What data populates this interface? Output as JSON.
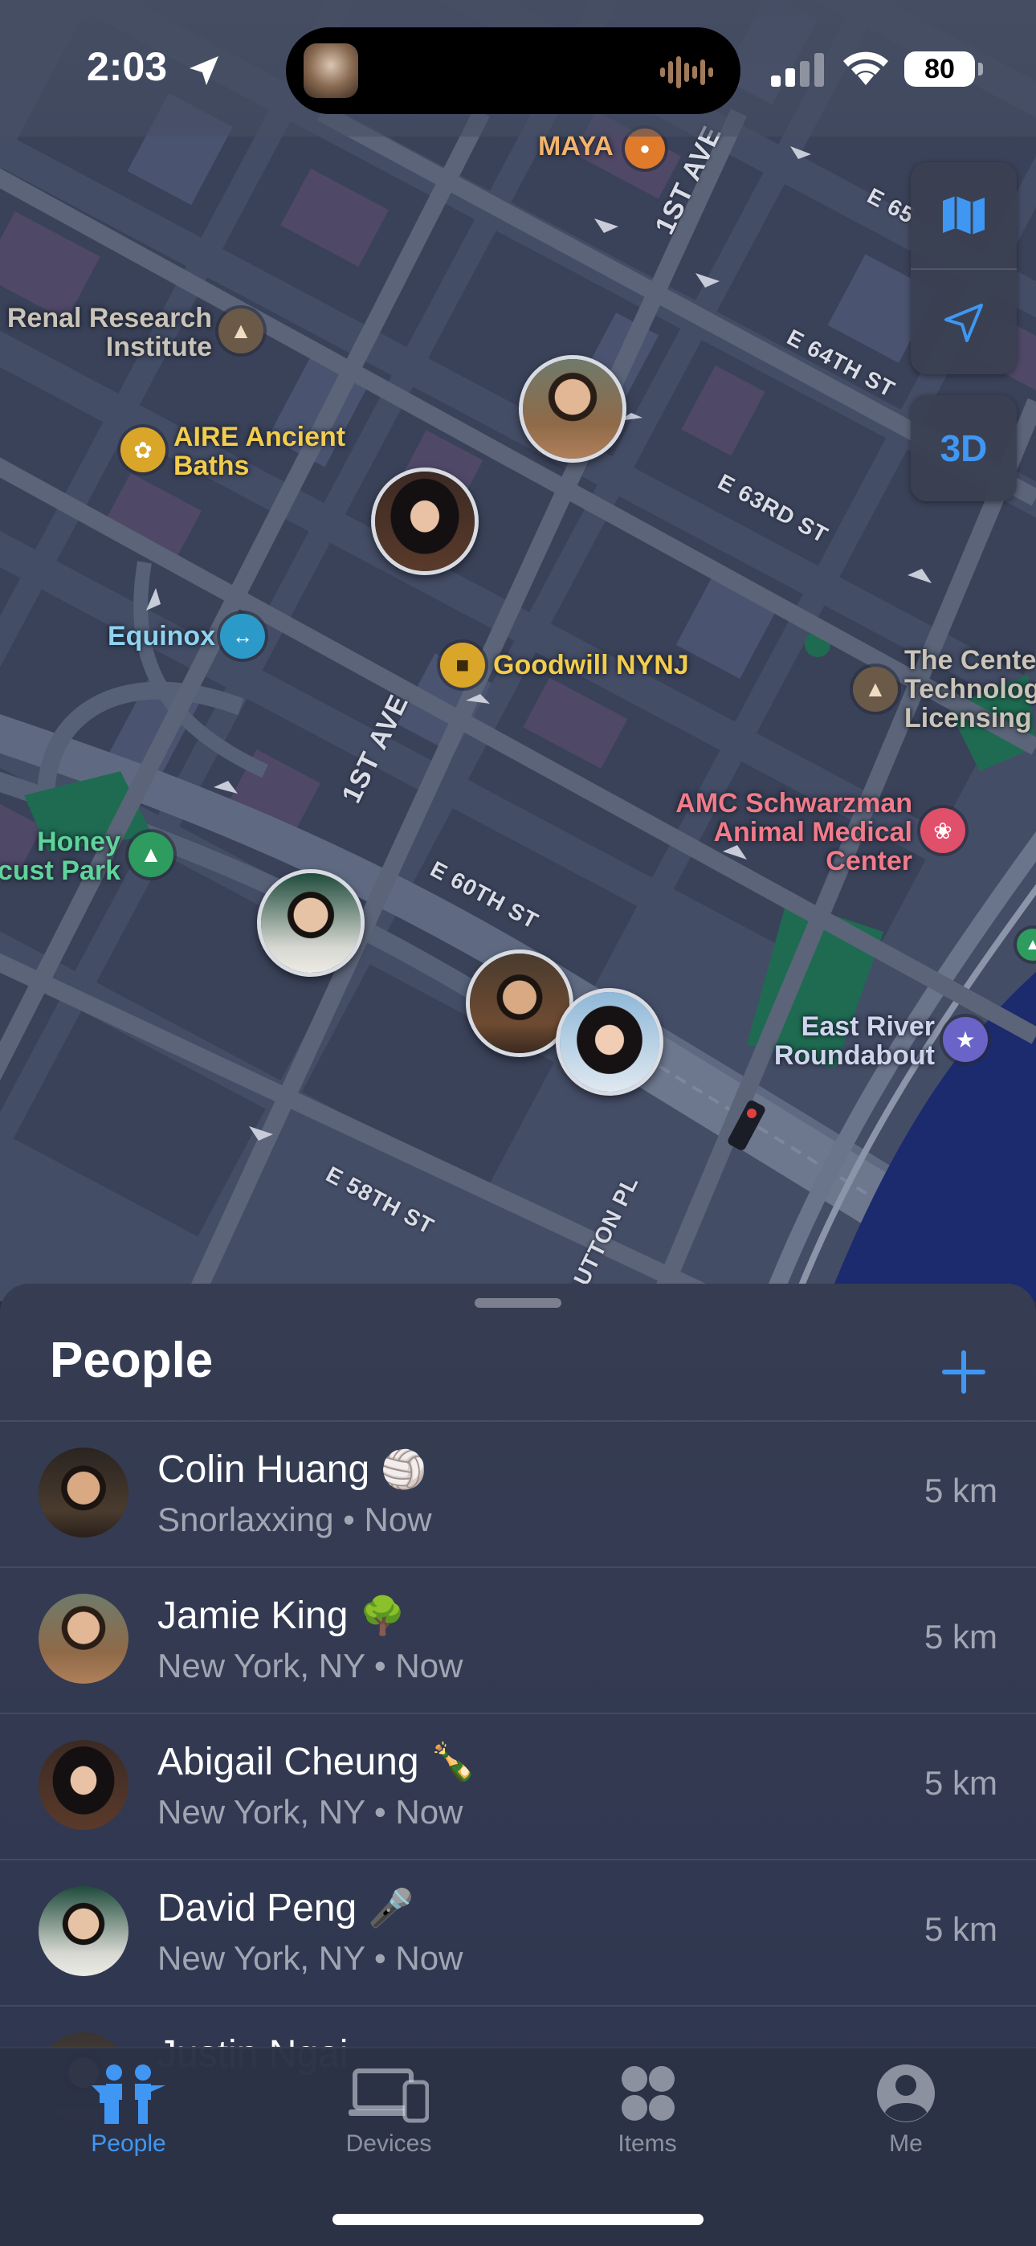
{
  "status_bar": {
    "time": "2:03",
    "battery": "80"
  },
  "map": {
    "places": {
      "maya": "MAYA",
      "renal": "Renal Research\nInstitute",
      "aire": "AIRE Ancient\nBaths",
      "equinox": "Equinox",
      "goodwill": "Goodwill NYNJ",
      "center": "The Cente\nTechnolog\nLicensing",
      "amc": "AMC Schwarzman\nAnimal Medical\nCenter",
      "honey": "Honey\ncust Park",
      "east_river": "East River\nRoundabout"
    },
    "streets": {
      "first_ave_top": "1ST AVE",
      "first_ave_mid": "1ST AVE",
      "e65": "E 65",
      "e64": "E 64TH ST",
      "e63": "E 63RD ST",
      "e60": "E 60TH ST",
      "e58": "E 58TH ST",
      "sutton": "SUTTON PL"
    },
    "controls": {
      "three_d": "3D"
    }
  },
  "sheet": {
    "title": "People",
    "people": [
      {
        "name": "Colin Huang",
        "emoji": "🏐",
        "location": "Snorlaxxing",
        "time": "Now",
        "distance": "5 km"
      },
      {
        "name": "Jamie King",
        "emoji": "🌳",
        "location": "New York, NY",
        "time": "Now",
        "distance": "5 km"
      },
      {
        "name": "Abigail Cheung",
        "emoji": "🍾",
        "location": "New York, NY",
        "time": "Now",
        "distance": "5 km"
      },
      {
        "name": "David Peng",
        "emoji": "🎤",
        "location": "New York, NY",
        "time": "Now",
        "distance": "5 km"
      },
      {
        "name": "Justin Ngai",
        "emoji": "",
        "location": "",
        "time": "",
        "distance": ""
      }
    ]
  },
  "tabs": [
    {
      "label": "People",
      "active": true
    },
    {
      "label": "Devices",
      "active": false
    },
    {
      "label": "Items",
      "active": false
    },
    {
      "label": "Me",
      "active": false
    }
  ],
  "colors": {
    "accent": "#3f97f3",
    "map_road": "#5b6478",
    "map_block": "#3e4760",
    "map_block_pink": "#5a4c6c",
    "water": "#1c2a6e",
    "park": "#1f6b52"
  }
}
